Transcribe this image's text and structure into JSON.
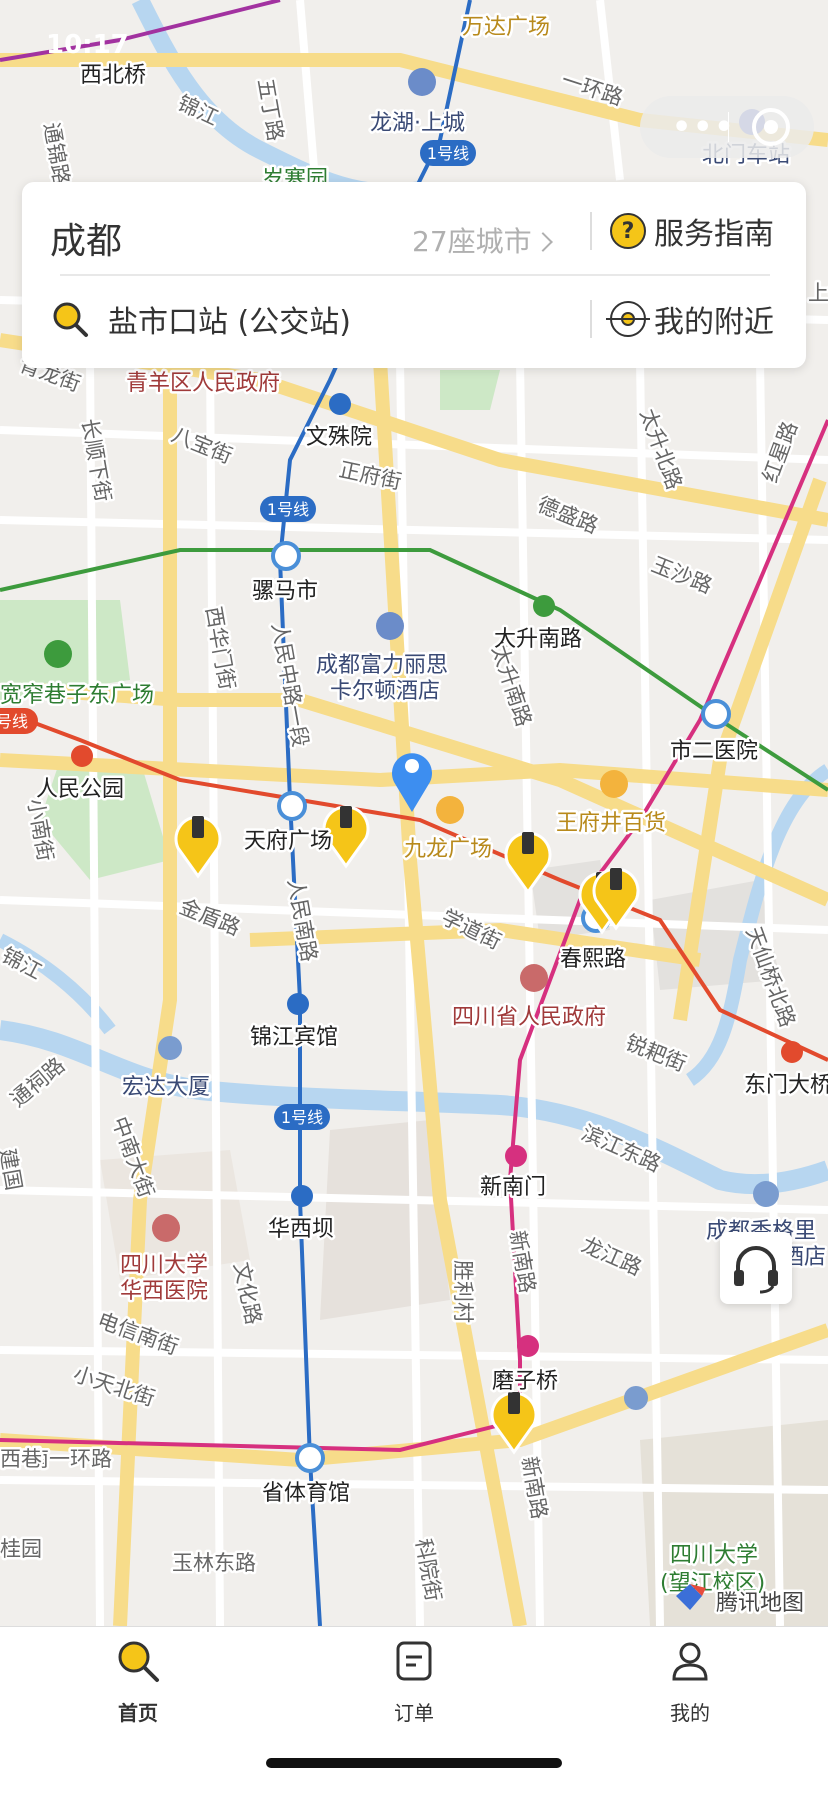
{
  "status_bar": {
    "time": "10:17"
  },
  "capsule": {
    "more": "•••"
  },
  "search_card": {
    "city": "成都",
    "city_count": "27座城市",
    "guide_label": "服务指南",
    "search_text": "盐市口站 (公交站)",
    "nearby_label": "我的附近"
  },
  "map": {
    "watermark": "腾讯地图",
    "line_badge": "1号线",
    "line_badge_left": "号线",
    "stations": [
      "西北桥",
      "文殊院",
      "骡马市",
      "天府广场",
      "锦江宾馆",
      "华西坝",
      "省体育馆",
      "人民公园",
      "太升南路",
      "市二医院",
      "春熙路",
      "新南门",
      "磨子桥",
      "东门大桥",
      "北门车站"
    ],
    "pois": [
      "万达广场",
      "龙湖·上城",
      "成都富力丽思",
      "卡尔顿酒店",
      "宏达大厦",
      "成都香格里",
      "拉酒店"
    ],
    "gov": [
      "青羊区人民政府",
      "四川省人民政府",
      "四川大学",
      "华西医院"
    ],
    "malls": [
      "九龙广场",
      "王府井百货"
    ],
    "parks": [
      "宽窄巷子东广场",
      "四川大学",
      "(望江校区)",
      "岁寒园"
    ],
    "streets": [
      "锦江",
      "五丁路",
      "通锦路",
      "一环路",
      "青龙街",
      "长顺下街",
      "八宝街",
      "正府街",
      "西华门街",
      "人民中路一段",
      "德盛路",
      "玉沙路",
      "太升北路",
      "太升南路",
      "红星路",
      "小南街",
      "金盾路",
      "学道街",
      "人民南路",
      "锦江",
      "锐耙街",
      "天仙桥北路",
      "通祠路",
      "中南大街",
      "滨江东路",
      "龙江路",
      "新南路",
      "电信南街",
      "小天北街",
      "玉林东路",
      "科院街",
      "胜利村",
      "文化路",
      "南一环路",
      "新南路",
      "西巷",
      "建国",
      "桂园",
      "上锦"
    ]
  },
  "tabs": [
    {
      "label": "首页",
      "icon": "search-icon"
    },
    {
      "label": "订单",
      "icon": "order-icon"
    },
    {
      "label": "我的",
      "icon": "user-icon"
    }
  ],
  "colors": {
    "accent": "#f5c518",
    "line1": "#2b6cc4",
    "line2": "#e24a2d",
    "line3": "#d6307f",
    "line4": "#3d9b3d"
  }
}
